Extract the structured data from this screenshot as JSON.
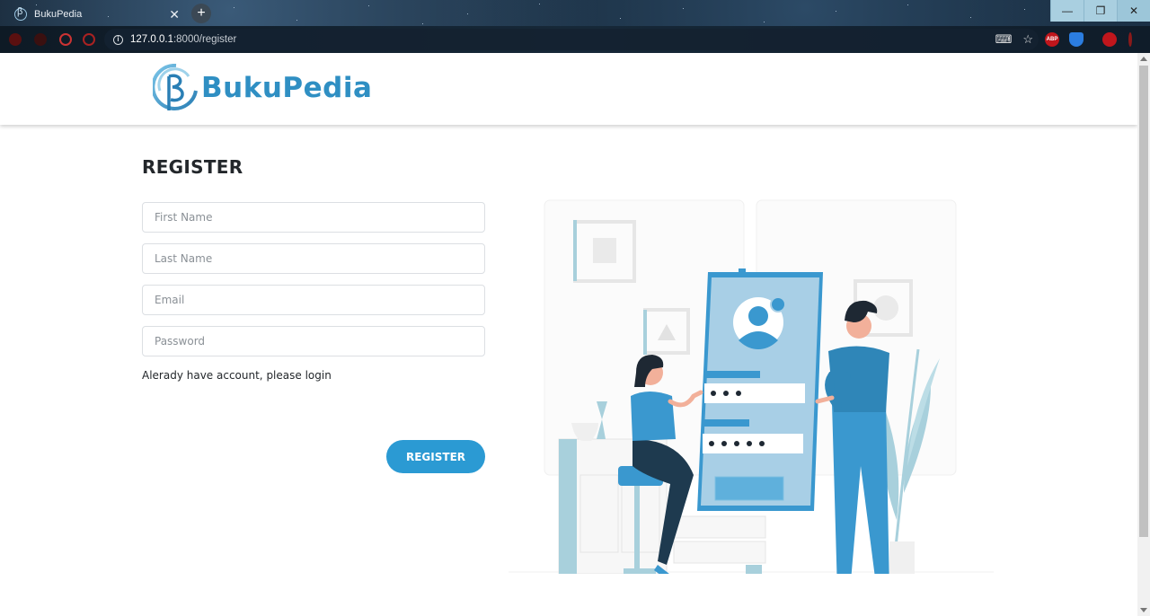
{
  "browser": {
    "tab_title": "BukuPedia",
    "tab_close": "✕",
    "new_tab": "+",
    "url_host": "127.0.0.1",
    "url_path": ":8000/register",
    "win_min": "—",
    "win_restore": "❐",
    "win_close": "✕",
    "ext_abp": "ABP"
  },
  "site": {
    "logo_text": "BukuPedia"
  },
  "form": {
    "title": "REGISTER",
    "first_name_placeholder": "First Name",
    "last_name_placeholder": "Last Name",
    "email_placeholder": "Email",
    "password_placeholder": "Password",
    "login_link": "Alerady have account, please login",
    "submit_label": "REGISTER"
  },
  "colors": {
    "accent": "#2b9ad3",
    "logo": "#2f8fc3",
    "illustration_primary": "#3399cc",
    "illustration_light": "#a8cfe6"
  }
}
